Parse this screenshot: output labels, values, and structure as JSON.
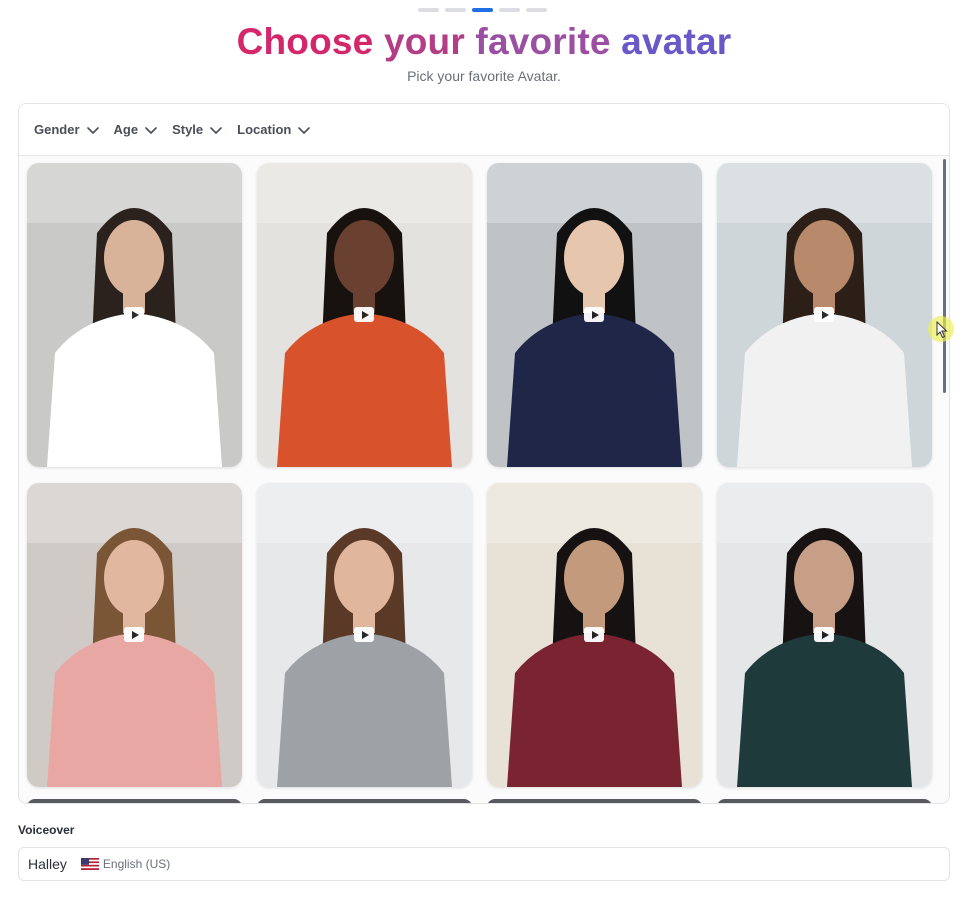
{
  "header": {
    "steps_total": 5,
    "active_step": 3,
    "title_words": [
      "Choose",
      "your",
      "favorite",
      "avatar"
    ],
    "subtitle": "Pick your favorite Avatar."
  },
  "filters": [
    {
      "label": "Gender",
      "icon": "chevron-down-icon"
    },
    {
      "label": "Age",
      "icon": "chevron-down-icon"
    },
    {
      "label": "Style",
      "icon": "chevron-down-icon"
    },
    {
      "label": "Location",
      "icon": "chevron-down-icon"
    }
  ],
  "avatars": [
    {
      "icon": "play-icon",
      "bg": "#c9c9c7",
      "top": "#ffffff",
      "hair": "#2c221d",
      "skin": "#d9b29a"
    },
    {
      "icon": "play-icon",
      "bg": "#e4e2de",
      "top": "#d8532c",
      "hair": "#18120f",
      "skin": "#6a4130"
    },
    {
      "icon": "play-icon",
      "bg": "#bfc3c6",
      "top": "#1f2648",
      "hair": "#111111",
      "skin": "#e6c6ad"
    },
    {
      "icon": "play-icon",
      "bg": "#cfd6d9",
      "top": "#f1f1f1",
      "hair": "#2b1f18",
      "skin": "#b88a6b"
    },
    {
      "icon": "play-icon",
      "bg": "#cfcac6",
      "top": "#e9a7a3",
      "hair": "#7a5536",
      "skin": "#e2b79f"
    },
    {
      "icon": "play-icon",
      "bg": "#e6e8ea",
      "top": "#9ea2a6",
      "hair": "#5a3a26",
      "skin": "#e0b69c"
    },
    {
      "icon": "play-icon",
      "bg": "#e7e1d6",
      "top": "#7a2331",
      "hair": "#151211",
      "skin": "#c49a7c"
    },
    {
      "icon": "play-icon",
      "bg": "#e5e6e8",
      "top": "#1f3a3b",
      "hair": "#171312",
      "skin": "#c79f86"
    }
  ],
  "voiceover": {
    "label": "Voiceover",
    "name": "Halley",
    "flag_icon": "us-flag-icon",
    "language": "English (US)"
  },
  "colors": {
    "accent": "#1f6fe5",
    "title_start": "#d4266a",
    "title_end": "#6a58c8"
  }
}
